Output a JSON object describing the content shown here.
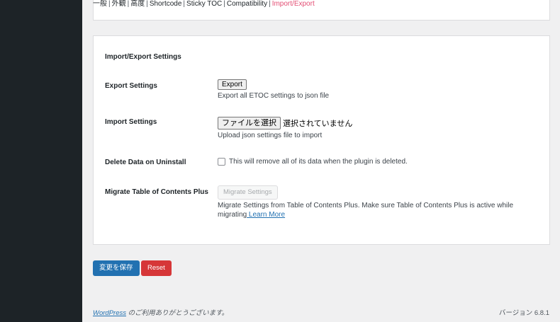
{
  "subnav": {
    "items": [
      "一般",
      "外観",
      "高度",
      "Shortcode",
      "Sticky TOC",
      "Compatibility",
      "Import/Export"
    ],
    "separator": "|",
    "active_index": 6,
    "active_color": "#e34e74"
  },
  "panel": {
    "title": "Import/Export Settings",
    "export": {
      "label": "Export Settings",
      "button": "Export",
      "description": "Export all ETOC settings to json file"
    },
    "import": {
      "label": "Import Settings",
      "file_button": "ファイルを選択",
      "file_status": "選択されていません",
      "description": "Upload json settings file to import"
    },
    "delete": {
      "label": "Delete Data on Uninstall",
      "checked": false,
      "text": "This will remove all of its data when the plugin is deleted."
    },
    "migrate": {
      "label": "Migrate Table of Contents Plus",
      "button": "Migrate Settings",
      "description": "Migrate Settings from Table of Contents Plus. Make sure Table of Contents Plus is active while migrating",
      "link": " Learn More"
    }
  },
  "actions": {
    "save": "変更を保存",
    "reset": "Reset"
  },
  "footer": {
    "link": "WordPress",
    "text": " のご利用ありがとうございます。",
    "version": "バージョン 6.8.1"
  },
  "colors": {
    "primary": "#2271b1",
    "danger": "#d63638",
    "sidebar": "#1d2327"
  }
}
